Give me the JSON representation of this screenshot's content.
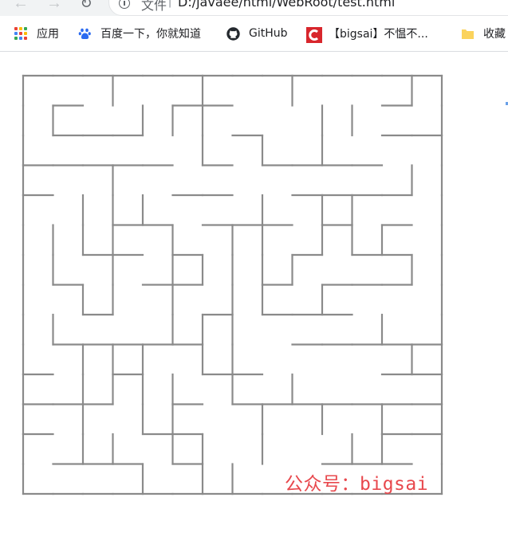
{
  "browser": {
    "nav": {
      "back_icon": "arrow-left-icon",
      "forward_icon": "arrow-right-icon",
      "reload_icon": "reload-icon"
    },
    "omnibox": {
      "info_icon": "info-icon",
      "scheme_label": "文件",
      "separator": "|",
      "url": "D:/javaee/html/WebRoot/test.html"
    }
  },
  "bookmarks": [
    {
      "icon": "apps-icon",
      "label": "应用"
    },
    {
      "icon": "baidu-paw-icon",
      "label": "百度一下，你就知道"
    },
    {
      "icon": "github-icon",
      "label": "GitHub"
    },
    {
      "icon": "bigsai-c-icon",
      "label": "【bigsai】不愠不..."
    },
    {
      "icon": "folder-icon",
      "label": "收藏"
    }
  ],
  "colors": {
    "maze_wall": "#8a8a8a",
    "watermark": "#e8484d",
    "apps": [
      "#ea4335",
      "#fbbc05",
      "#34a853",
      "#4285f4",
      "#ea4335",
      "#fbbc05",
      "#34a853",
      "#4285f4",
      "#ea4335"
    ],
    "baidu": "#2b6bf0",
    "bigsai": "#d8262c",
    "folder": "#fbd35c"
  },
  "maze": {
    "grid_size": 14,
    "horizontal_walls": [
      [
        0,
        0,
        1
      ],
      [
        0,
        1,
        1
      ],
      [
        0,
        2,
        1
      ],
      [
        0,
        3,
        1
      ],
      [
        0,
        4,
        1
      ],
      [
        0,
        5,
        1
      ],
      [
        0,
        6,
        1
      ],
      [
        0,
        7,
        1
      ],
      [
        0,
        8,
        1
      ],
      [
        0,
        9,
        1
      ],
      [
        0,
        10,
        1
      ],
      [
        0,
        11,
        1
      ],
      [
        0,
        12,
        1
      ],
      [
        0,
        13,
        1
      ],
      [
        1,
        1,
        1
      ],
      [
        1,
        5,
        1
      ],
      [
        1,
        6,
        1
      ],
      [
        1,
        12,
        1
      ],
      [
        2,
        1,
        1
      ],
      [
        2,
        2,
        1
      ],
      [
        2,
        3,
        1
      ],
      [
        2,
        7,
        1
      ],
      [
        2,
        12,
        1
      ],
      [
        2,
        13,
        1
      ],
      [
        3,
        0,
        1
      ],
      [
        3,
        1,
        1
      ],
      [
        3,
        2,
        1
      ],
      [
        3,
        3,
        1
      ],
      [
        3,
        4,
        1
      ],
      [
        3,
        6,
        1
      ],
      [
        3,
        8,
        1
      ],
      [
        3,
        9,
        1
      ],
      [
        3,
        10,
        1
      ],
      [
        3,
        11,
        1
      ],
      [
        4,
        0,
        1
      ],
      [
        4,
        5,
        1
      ],
      [
        4,
        6,
        1
      ],
      [
        4,
        9,
        1
      ],
      [
        4,
        10,
        1
      ],
      [
        4,
        11,
        1
      ],
      [
        4,
        12,
        1
      ],
      [
        5,
        3,
        1
      ],
      [
        5,
        4,
        1
      ],
      [
        5,
        6,
        1
      ],
      [
        5,
        7,
        1
      ],
      [
        5,
        8,
        1
      ],
      [
        5,
        10,
        1
      ],
      [
        5,
        12,
        1
      ],
      [
        6,
        2,
        1
      ],
      [
        6,
        3,
        1
      ],
      [
        6,
        5,
        1
      ],
      [
        6,
        9,
        1
      ],
      [
        6,
        11,
        1
      ],
      [
        6,
        12,
        1
      ],
      [
        7,
        1,
        1
      ],
      [
        7,
        4,
        1
      ],
      [
        7,
        5,
        1
      ],
      [
        7,
        8,
        1
      ],
      [
        7,
        10,
        1
      ],
      [
        7,
        11,
        1
      ],
      [
        7,
        12,
        1
      ],
      [
        8,
        2,
        1
      ],
      [
        8,
        6,
        1
      ],
      [
        8,
        8,
        1
      ],
      [
        8,
        9,
        1
      ],
      [
        8,
        10,
        1
      ],
      [
        9,
        1,
        1
      ],
      [
        9,
        2,
        1
      ],
      [
        9,
        3,
        1
      ],
      [
        9,
        4,
        1
      ],
      [
        9,
        5,
        1
      ],
      [
        9,
        9,
        1
      ],
      [
        9,
        10,
        1
      ],
      [
        9,
        11,
        1
      ],
      [
        9,
        12,
        1
      ],
      [
        9,
        13,
        1
      ],
      [
        10,
        0,
        1
      ],
      [
        10,
        3,
        1
      ],
      [
        10,
        6,
        1
      ],
      [
        10,
        7,
        1
      ],
      [
        10,
        12,
        1
      ],
      [
        10,
        13,
        1
      ],
      [
        11,
        0,
        1
      ],
      [
        11,
        1,
        1
      ],
      [
        11,
        2,
        1
      ],
      [
        11,
        5,
        1
      ],
      [
        11,
        7,
        1
      ],
      [
        11,
        8,
        1
      ],
      [
        11,
        9,
        1
      ],
      [
        11,
        10,
        1
      ],
      [
        11,
        11,
        1
      ],
      [
        11,
        12,
        1
      ],
      [
        11,
        13,
        1
      ],
      [
        12,
        0,
        1
      ],
      [
        12,
        4,
        1
      ],
      [
        12,
        5,
        1
      ],
      [
        12,
        12,
        1
      ],
      [
        12,
        13,
        1
      ],
      [
        13,
        1,
        1
      ],
      [
        13,
        2,
        1
      ],
      [
        13,
        3,
        1
      ],
      [
        13,
        5,
        1
      ],
      [
        13,
        10,
        1
      ],
      [
        13,
        11,
        1
      ],
      [
        13,
        12,
        1
      ],
      [
        14,
        0,
        1
      ],
      [
        14,
        1,
        1
      ],
      [
        14,
        2,
        1
      ],
      [
        14,
        3,
        1
      ],
      [
        14,
        4,
        1
      ],
      [
        14,
        5,
        1
      ],
      [
        14,
        6,
        1
      ],
      [
        14,
        7,
        1
      ],
      [
        14,
        8,
        1
      ],
      [
        14,
        9,
        1
      ],
      [
        14,
        10,
        1
      ],
      [
        14,
        11,
        1
      ],
      [
        14,
        12,
        1
      ],
      [
        14,
        13,
        1
      ]
    ],
    "vertical_walls": [
      [
        0,
        0,
        1
      ],
      [
        0,
        3,
        1
      ],
      [
        0,
        6,
        1
      ],
      [
        0,
        9,
        1
      ],
      [
        0,
        13,
        1
      ],
      [
        0,
        14,
        1
      ],
      [
        1,
        0,
        1
      ],
      [
        1,
        1,
        1
      ],
      [
        1,
        4,
        1
      ],
      [
        1,
        5,
        1
      ],
      [
        1,
        6,
        1
      ],
      [
        1,
        10,
        1
      ],
      [
        1,
        11,
        1
      ],
      [
        1,
        14,
        1
      ],
      [
        2,
        0,
        1
      ],
      [
        2,
        6,
        1
      ],
      [
        2,
        8,
        1
      ],
      [
        2,
        10,
        1
      ],
      [
        2,
        14,
        1
      ],
      [
        3,
        0,
        1
      ],
      [
        3,
        3,
        1
      ],
      [
        3,
        13,
        1
      ],
      [
        3,
        14,
        1
      ],
      [
        4,
        0,
        1
      ],
      [
        4,
        2,
        1
      ],
      [
        4,
        3,
        1
      ],
      [
        4,
        4,
        1
      ],
      [
        4,
        8,
        1
      ],
      [
        4,
        10,
        1
      ],
      [
        4,
        11,
        1
      ],
      [
        4,
        14,
        1
      ],
      [
        5,
        0,
        1
      ],
      [
        5,
        1,
        1
      ],
      [
        5,
        2,
        1
      ],
      [
        5,
        3,
        1
      ],
      [
        5,
        5,
        1
      ],
      [
        5,
        7,
        1
      ],
      [
        5,
        8,
        1
      ],
      [
        5,
        10,
        1
      ],
      [
        5,
        11,
        1
      ],
      [
        5,
        12,
        1
      ],
      [
        5,
        14,
        1
      ],
      [
        6,
        0,
        1
      ],
      [
        6,
        1,
        1
      ],
      [
        6,
        3,
        1
      ],
      [
        6,
        5,
        1
      ],
      [
        6,
        6,
        1
      ],
      [
        6,
        7,
        1
      ],
      [
        6,
        8,
        1
      ],
      [
        6,
        9,
        1
      ],
      [
        6,
        13,
        1
      ],
      [
        6,
        14,
        1
      ],
      [
        7,
        0,
        1
      ],
      [
        7,
        2,
        1
      ],
      [
        7,
        3,
        1
      ],
      [
        7,
        5,
        1
      ],
      [
        7,
        7,
        1
      ],
      [
        7,
        8,
        1
      ],
      [
        7,
        10,
        1
      ],
      [
        7,
        14,
        1
      ],
      [
        8,
        0,
        1
      ],
      [
        8,
        1,
        1
      ],
      [
        8,
        5,
        1
      ],
      [
        8,
        6,
        1
      ],
      [
        8,
        7,
        1
      ],
      [
        8,
        12,
        1
      ],
      [
        8,
        14,
        1
      ],
      [
        9,
        0,
        1
      ],
      [
        9,
        2,
        1
      ],
      [
        9,
        3,
        1
      ],
      [
        9,
        4,
        1
      ],
      [
        9,
        6,
        1
      ],
      [
        9,
        7,
        1
      ],
      [
        9,
        13,
        1
      ],
      [
        9,
        14,
        1
      ],
      [
        10,
        0,
        1
      ],
      [
        10,
        2,
        1
      ],
      [
        10,
        3,
        1
      ],
      [
        10,
        4,
        1
      ],
      [
        10,
        5,
        1
      ],
      [
        10,
        7,
        1
      ],
      [
        10,
        9,
        1
      ],
      [
        10,
        14,
        1
      ],
      [
        11,
        0,
        1
      ],
      [
        11,
        2,
        1
      ],
      [
        11,
        4,
        1
      ],
      [
        11,
        5,
        1
      ],
      [
        11,
        8,
        1
      ],
      [
        11,
        10,
        1
      ],
      [
        11,
        12,
        1
      ],
      [
        11,
        14,
        1
      ],
      [
        12,
        0,
        1
      ],
      [
        12,
        2,
        1
      ],
      [
        12,
        3,
        1
      ],
      [
        12,
        5,
        1
      ],
      [
        12,
        6,
        1
      ],
      [
        12,
        8,
        1
      ],
      [
        12,
        11,
        1
      ],
      [
        12,
        12,
        1
      ],
      [
        12,
        14,
        1
      ],
      [
        13,
        0,
        1
      ],
      [
        13,
        4,
        1
      ],
      [
        13,
        6,
        1
      ],
      [
        13,
        7,
        1
      ],
      [
        13,
        14,
        1
      ]
    ]
  },
  "watermark": "公众号：bigsai"
}
